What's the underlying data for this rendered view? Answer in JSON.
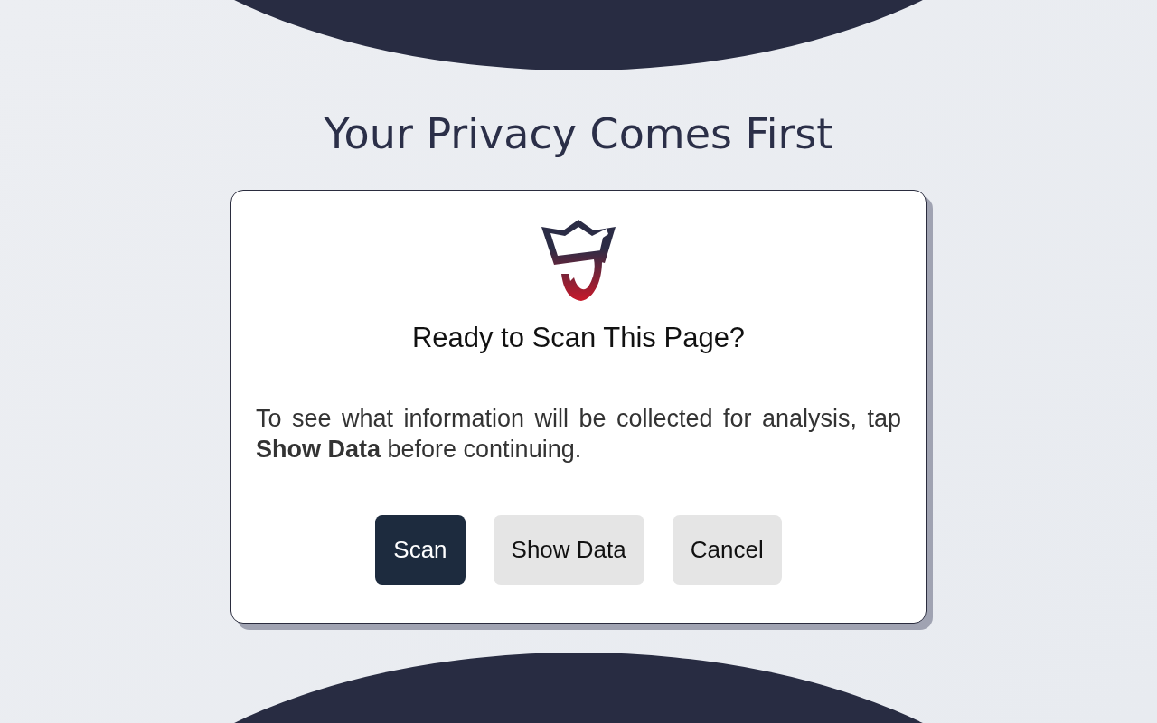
{
  "title": "Your Privacy Comes First",
  "dialog": {
    "heading": "Ready to Scan This Page?",
    "message": "To see what information will be collected for analysis, tap **Show Data** before continuing.",
    "buttons": [
      {
        "label": "Scan",
        "kind": "primary"
      },
      {
        "label": "Show Data",
        "kind": "secondary"
      },
      {
        "label": "Cancel",
        "kind": "secondary"
      }
    ]
  }
}
